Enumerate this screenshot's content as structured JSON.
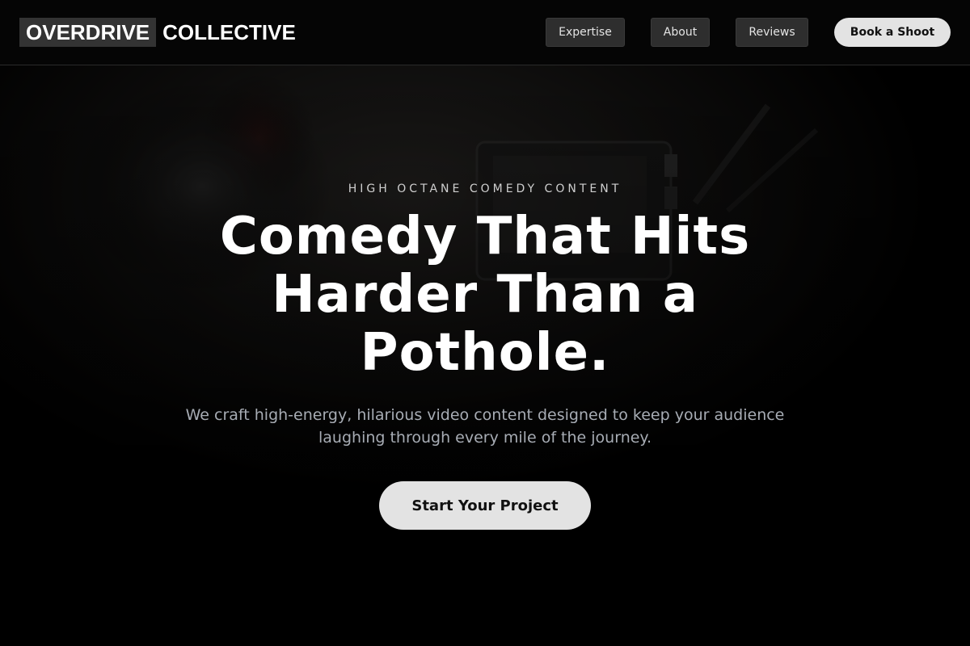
{
  "brand": {
    "logo_box": "OVERDRIVE",
    "logo_rest": "COLLECTIVE"
  },
  "nav": {
    "items": [
      {
        "label": "Expertise"
      },
      {
        "label": "About"
      },
      {
        "label": "Reviews"
      }
    ],
    "cta_label": "Book a Shoot"
  },
  "hero": {
    "eyebrow": "HIGH OCTANE COMEDY CONTENT",
    "headline": "Comedy That Hits Harder Than a Pothole.",
    "subtext": "We craft high-energy, hilarious video content designed to keep your audience laughing through every mile of the journey.",
    "cta_label": "Start Your Project",
    "background_image": "dark-camera-film-set-photo"
  },
  "colors": {
    "page_background": "#000000",
    "button_light": "#e3e3e3",
    "nav_button": "#2e2e2e",
    "logo_box": "#333333",
    "subtext": "#a7acb4"
  }
}
